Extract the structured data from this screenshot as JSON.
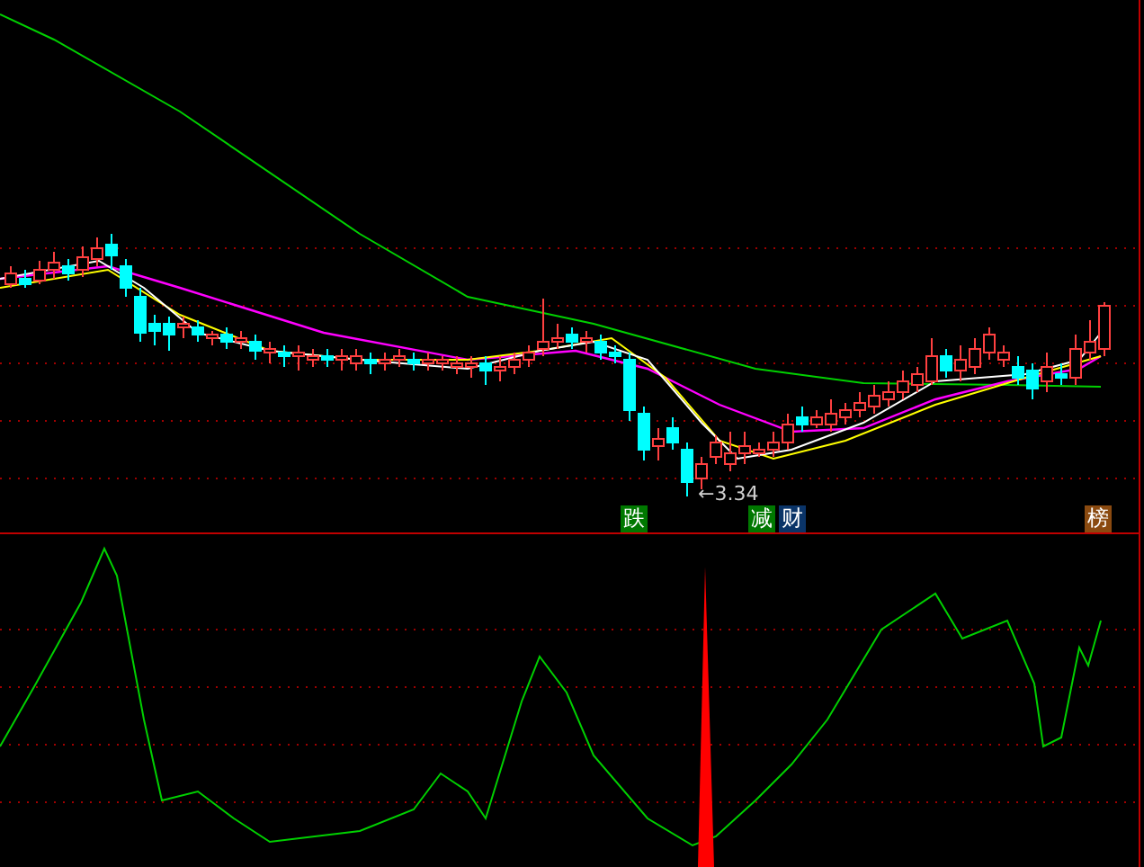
{
  "price_chart": {
    "low_label": "←3.34",
    "markers": [
      {
        "text": "跌",
        "color": "#007800"
      },
      {
        "text": "减",
        "color": "#007800"
      },
      {
        "text": "财",
        "color": "#0a3468"
      },
      {
        "text": "榜",
        "color": "#8a4a10"
      }
    ]
  }
}
